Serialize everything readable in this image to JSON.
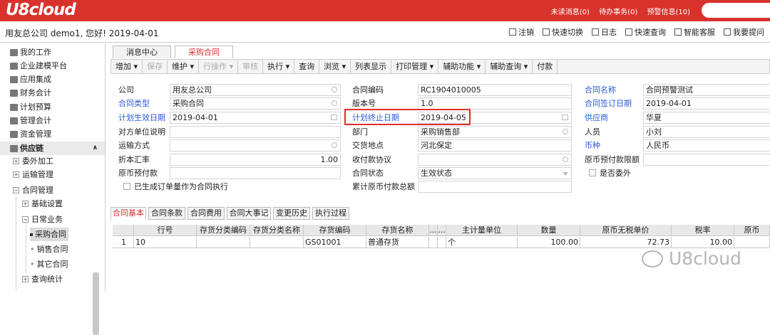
{
  "brand": {
    "logo": "U8cloud"
  },
  "topnav": [
    "未读消息(0)",
    "待办事务(0)",
    "预警信息(10)"
  ],
  "userbar": {
    "greeting": "用友总公司 demo1, 您好! 2019-04-01",
    "tools": [
      "注销",
      "快速切换",
      "日志",
      "快速查询",
      "智能客服",
      "我要提问"
    ]
  },
  "sidebar": {
    "items": [
      "我的工作",
      "企业建模平台",
      "应用集成",
      "财务会计",
      "计划预算",
      "管理会计",
      "资金管理"
    ],
    "section": "供应链",
    "tree": [
      "委外加工",
      "运输管理",
      "合同管理",
      "基础设置",
      "日常业务",
      "采购合同",
      "销售合同",
      "其它合同",
      "查询统计"
    ]
  },
  "tabs": [
    "消息中心",
    "采购合同"
  ],
  "toolbar": [
    "增加",
    "保存",
    "维护",
    "行操作",
    "审核",
    "执行",
    "查询",
    "浏览",
    "列表显示",
    "打印管理",
    "辅助功能",
    "辅助查询",
    "付款"
  ],
  "form": {
    "labels": [
      "公司",
      "合同类型",
      "计划生效日期",
      "对方单位说明",
      "运输方式",
      "折本汇率",
      "原币预付款",
      "合同编码",
      "版本号",
      "计划终止日期",
      "部门",
      "交货地点",
      "收付款协议",
      "合同状态",
      "累计原币付款总额",
      "合同名称",
      "合同签订日期",
      "供应商",
      "人员",
      "币种",
      "原币预付款限额",
      "是否委外",
      "已生成订单量作为合同执行"
    ],
    "values": [
      "用友总公司",
      "采购合同",
      "2019-04-01",
      "1.00",
      "RC1904010005",
      "1.0",
      "2019-04-05",
      "采购销售部",
      "河北保定",
      "生效状态",
      "合同预警测试",
      "2019-04-01",
      "华夏",
      "小刘",
      "人民币"
    ]
  },
  "body_tabs": [
    "合同基本",
    "合同条款",
    "合同费用",
    "合同大事记",
    "变更历史",
    "执行过程"
  ],
  "grid": {
    "headers": [
      "",
      "行号",
      "存货分类编码",
      "存货分类名称",
      "存货编码",
      "存货名称",
      "...",
      "...",
      "主计量单位",
      "数量",
      "原币无税单价",
      "税率",
      "原币"
    ],
    "row": [
      "1",
      "10",
      "",
      "",
      "GS01001",
      "普通存货",
      "",
      "",
      "个",
      "100.00",
      "72.73",
      "10.00",
      ""
    ]
  },
  "watermark": "U8cloud",
  "colors": {
    "brand": "#d9322c",
    "link": "#2a5bd7"
  }
}
